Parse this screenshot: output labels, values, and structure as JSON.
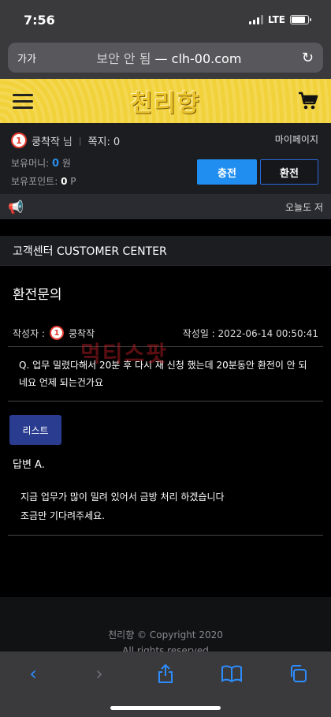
{
  "status": {
    "time": "7:56",
    "carrier": "LTE"
  },
  "browser": {
    "text_size_label": "가가",
    "insecure_label": "보안 안 됨",
    "separator": " — ",
    "domain": "clh-00.com"
  },
  "site": {
    "logo_text": "천리향"
  },
  "user": {
    "rank_badge": "1",
    "name": "쿵착작",
    "honorific": "님",
    "messages_label": "쪽지:",
    "messages_count": "0",
    "mypage_label": "마이페이지",
    "money_label": "보유머니:",
    "money_value": "0",
    "money_unit": "원",
    "points_label": "보유포인트:",
    "points_value": "0",
    "points_unit": "P",
    "charge_button": "충전",
    "exchange_button": "환전"
  },
  "notice": {
    "text": "오늘도 저"
  },
  "section": {
    "title": "고객센터 CUSTOMER CENTER"
  },
  "post": {
    "title": "환전문의",
    "author_label": "작성자 :",
    "author_name": "쿵착작",
    "date_label": "작성일 :",
    "date_value": "2022-06-14 00:50:41",
    "question": "Q. 업무 밀렸다해서 20분 후 다시 재 신청 했는데 20분동안 환전이 안 되네요 언제 되는건가요",
    "list_button": "리스트",
    "answer_label": "답변 A.",
    "answer_line1": "지금 업무가 많이 밀려 있어서 금방 처리 하겠습니다",
    "answer_line2": "조금만 기다려주세요."
  },
  "watermark": {
    "text": "먹티스팟"
  },
  "footer": {
    "copyright": "천리향 © Copyright 2020",
    "rights": "All rights reserved"
  },
  "colors": {
    "header_yellow": "#f2d23a",
    "accent_blue": "#1f8ef0",
    "list_button": "#2a3c8f",
    "badge_red": "#e23b2f"
  }
}
